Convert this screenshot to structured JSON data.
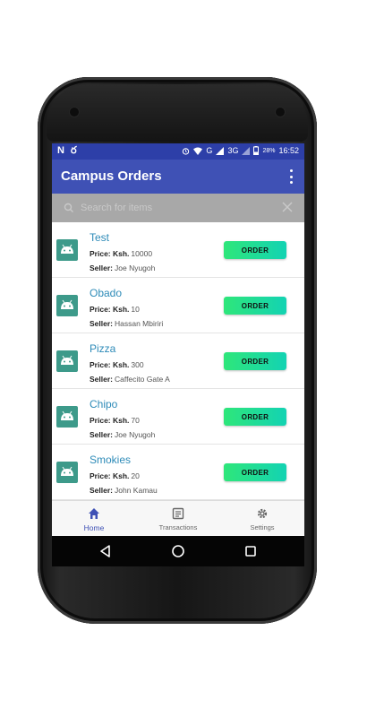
{
  "statusbar": {
    "left_icons": "N ర",
    "battery": "28%",
    "network": "3G",
    "g_label": "G",
    "time": "16:52"
  },
  "appbar": {
    "title": "Campus Orders"
  },
  "search": {
    "placeholder": "Search for items",
    "value": ""
  },
  "items": [
    {
      "name": "Test",
      "price_label": "Price: Ksh.",
      "price": "10000",
      "seller_label": "Seller:",
      "seller": "Joe Nyugoh",
      "button": "ORDER"
    },
    {
      "name": "Obado",
      "price_label": "Price: Ksh.",
      "price": "10",
      "seller_label": "Seller:",
      "seller": "Hassan Mbiriri",
      "button": "ORDER"
    },
    {
      "name": "Pizza",
      "price_label": "Price: Ksh.",
      "price": "300",
      "seller_label": "Seller:",
      "seller": "Caffecito Gate A",
      "button": "ORDER"
    },
    {
      "name": "Chipo",
      "price_label": "Price: Ksh.",
      "price": "70",
      "seller_label": "Seller:",
      "seller": "Joe Nyugoh",
      "button": "ORDER"
    },
    {
      "name": "Smokies",
      "price_label": "Price: Ksh.",
      "price": "20",
      "seller_label": "Seller:",
      "seller": "John Kamau",
      "button": "ORDER"
    }
  ],
  "bottom_nav": [
    {
      "label": "Home",
      "icon": "home-icon",
      "active": true
    },
    {
      "label": "Transactions",
      "icon": "list-icon",
      "active": false
    },
    {
      "label": "Settings",
      "icon": "gear-icon",
      "active": false
    }
  ],
  "colors": {
    "primary": "#3f51b5",
    "status_bar": "#2d3fa8",
    "accent_text": "#2e8bb8",
    "button_gradient_start": "#2ee67a",
    "button_gradient_end": "#13d3b3",
    "thumbnail": "#3d9a8a"
  }
}
